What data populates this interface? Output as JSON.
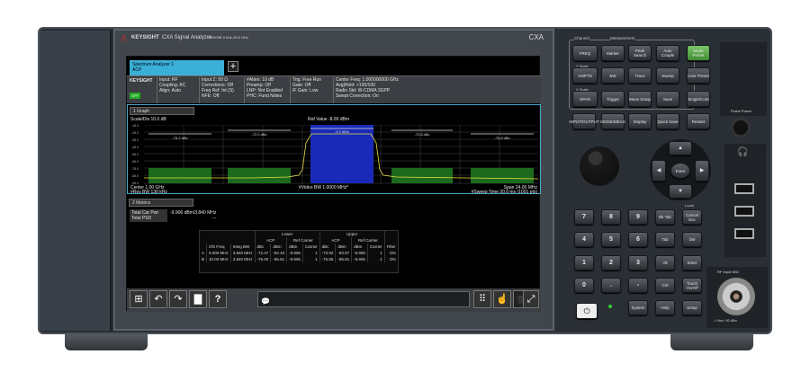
{
  "device": {
    "brand": "KEYSIGHT",
    "product": "CXA Signal Analyzer",
    "model_info": "N9000B 9 kHz-26.5 GHz",
    "badge": "CXA"
  },
  "screen": {
    "tab": {
      "title": "Spectrum Analyzer 1",
      "subtitle": "ACP",
      "add": "+"
    },
    "info": {
      "logo": "KEYSIGHT",
      "status": "OFF",
      "col1": [
        "Input: RF",
        "Coupling: AC",
        "Align: Auto"
      ],
      "col2": [
        "Input Z: 50 Ω",
        "Corrections: Off",
        "Freq Ref: Int (S)",
        "NFE: Off"
      ],
      "col3": [
        "#Atten: 10 dB",
        "Preamp: Off",
        "LNP: Not Enabled",
        "PHC: Fund Notes"
      ],
      "col4": [
        "Trig: Free Run",
        "Gate: Off",
        "IF Gain: Low"
      ],
      "col5": [
        "Center Freq: 1.000000000 GHz",
        "Avg|Hold: >100/100",
        "Radio Std: W-CDMA 3GPP",
        "Swept Correction: On"
      ]
    },
    "graph": {
      "header": "1 Graph",
      "scale": "Scale/Div 10.0 dB",
      "ref": "Ref Value -8.00 dBm",
      "y_ticks": [
        "-18.0",
        "-28.0",
        "-38.0",
        "-48.0",
        "-58.0",
        "-68.0",
        "-78.0",
        "-88.0",
        "-98.0"
      ],
      "channel_labels": [
        "-76.2 dBc",
        "-72.0 dBc",
        "-9.9 dBm",
        "-72.8 dBc",
        "-75.8 dBc"
      ],
      "center": "Center 1.00 GHz",
      "res_bw": "#Res BW 130 kHz",
      "video_bw": "#Video BW 1.0000 MHz*",
      "span": "Span 24.00 MHz",
      "sweep": "#Sweep Time 20.0 ms (1001 pts)",
      "trace_color": "#e8e040",
      "carrier_color": "#1a2ab8",
      "limit_color": "#1d6a1d"
    },
    "metrics": {
      "header": "2 Metrics",
      "total_car_pwr_label": "Total Car Pwr",
      "total_car_pwr": "-9.906 dBm/3.840 MHz",
      "total_psd_label": "Total PSD",
      "total_psd": "---",
      "group_lower": "Lower",
      "group_upper": "Upper",
      "acp": "ACP",
      "ref_carrier": "Ref Carrier",
      "columns": [
        "",
        "Ofs Freq",
        "Integ BW",
        "dBc",
        "dBm",
        "dBm",
        "Carrier",
        "dBc",
        "dBm",
        "dBm",
        "Carrier",
        "Filter"
      ],
      "rows": [
        [
          "A",
          "5.000 MHz",
          "3.840 MHz",
          "-72.47",
          "-82.43",
          "-9.906",
          "1",
          "-73.92",
          "-83.87",
          "-9.906",
          "1",
          "ON"
        ],
        [
          "B",
          "10.00 MHz",
          "3.840 MHz",
          "-76.00",
          "-85.91",
          "-9.906",
          "1",
          "-75.85",
          "-85.81",
          "-9.906",
          "1",
          "ON"
        ]
      ]
    },
    "taskbar": {
      "windows": "⊞",
      "undo": "↶",
      "redo": "↷",
      "folder": "▇",
      "help": "?",
      "message": "",
      "keypad": "⠿",
      "touch": "☝",
      "grid": "▦",
      "fullscreen": "⤢"
    }
  },
  "panel": {
    "group_channel": "Channel",
    "group_measurement": "Measurement",
    "label_yscale": "Y Scale",
    "label_xscale": "X Scale",
    "keys": [
      "FREQ",
      "Marker",
      "Peak Search",
      "Auto Couple",
      "Mode Preset",
      "AMPTD",
      "BW",
      "Trace",
      "Sweep",
      "User Preset",
      "SPAN",
      "Trigger",
      "Meas Setup",
      "Save",
      "Single/Cont",
      "INPUT/OUTPUT",
      "MODE/MEAS",
      "Display",
      "Quick Save",
      "Restart"
    ],
    "nav": {
      "up": "▲",
      "down": "▼",
      "left": "◀",
      "right": "▶",
      "enter": "Enter"
    },
    "numpad": [
      "7",
      "8",
      "9",
      "Bk Tab",
      "Cancel Esc",
      "4",
      "5",
      "6",
      "Tab",
      "Del",
      "1",
      "2",
      "3",
      "Alt",
      "Enter",
      "0",
      ".",
      "-",
      "Ctrl",
      "Touch On/Off"
    ],
    "bottom": {
      "power": "⏻",
      "system": "System",
      "help": "Help",
      "setup": "Setup"
    },
    "label_local": "Local",
    "label_probe": "Probe Power",
    "label_rf": "RF Input 50Ω",
    "label_rf_warning": "⚠ Max +30 dBm"
  }
}
